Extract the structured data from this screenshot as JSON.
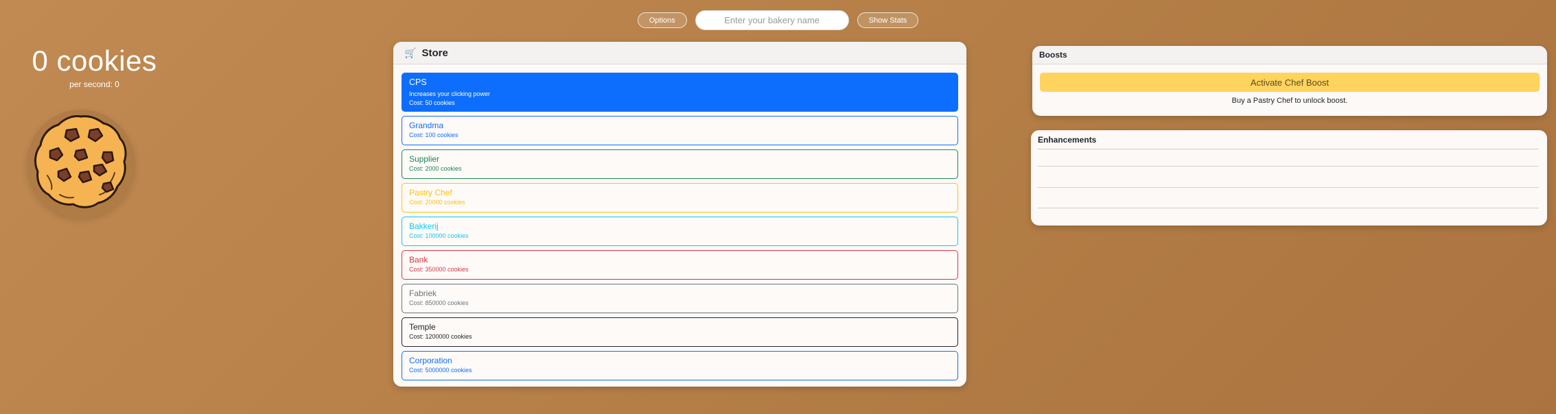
{
  "topbar": {
    "options_label": "Options",
    "bakery_name_placeholder": "Enter your bakery name",
    "bakery_name_value": "",
    "stats_label": "Show Stats"
  },
  "counter": {
    "cookies_text": "0 cookies",
    "per_second_text": "per second: 0"
  },
  "store": {
    "title": "Store",
    "icon": "cart-icon",
    "items": [
      {
        "name": "CPS",
        "desc": "Increases your clicking power",
        "cost": "Cost: 50 cookies",
        "color": "#0d6efd"
      },
      {
        "name": "Grandma",
        "cost": "Cost: 100 cookies",
        "color": "#0d6efd"
      },
      {
        "name": "Supplier",
        "cost": "Cost: 2000 cookies",
        "color": "#198754"
      },
      {
        "name": "Pastry Chef",
        "cost": "Cost: 20000 cookies",
        "color": "#ffc107"
      },
      {
        "name": "Bakkerij",
        "cost": "Cost: 100000 cookies",
        "color": "#0dcaf0"
      },
      {
        "name": "Bank",
        "cost": "Cost: 350000 cookies",
        "color": "#dc3545"
      },
      {
        "name": "Fabriek",
        "cost": "Cost: 850000 cookies",
        "color": "#6c757d"
      },
      {
        "name": "Temple",
        "cost": "Cost: 1200000 cookies",
        "color": "#212529"
      },
      {
        "name": "Corporation",
        "cost": "Cost: 5000000 cookies",
        "color": "#0d6efd"
      }
    ]
  },
  "boosts": {
    "title": "Boosts",
    "button_label": "Activate Chef Boost",
    "note": "Buy a Pastry Chef to unlock boost."
  },
  "enhancements": {
    "title": "Enhancements"
  }
}
